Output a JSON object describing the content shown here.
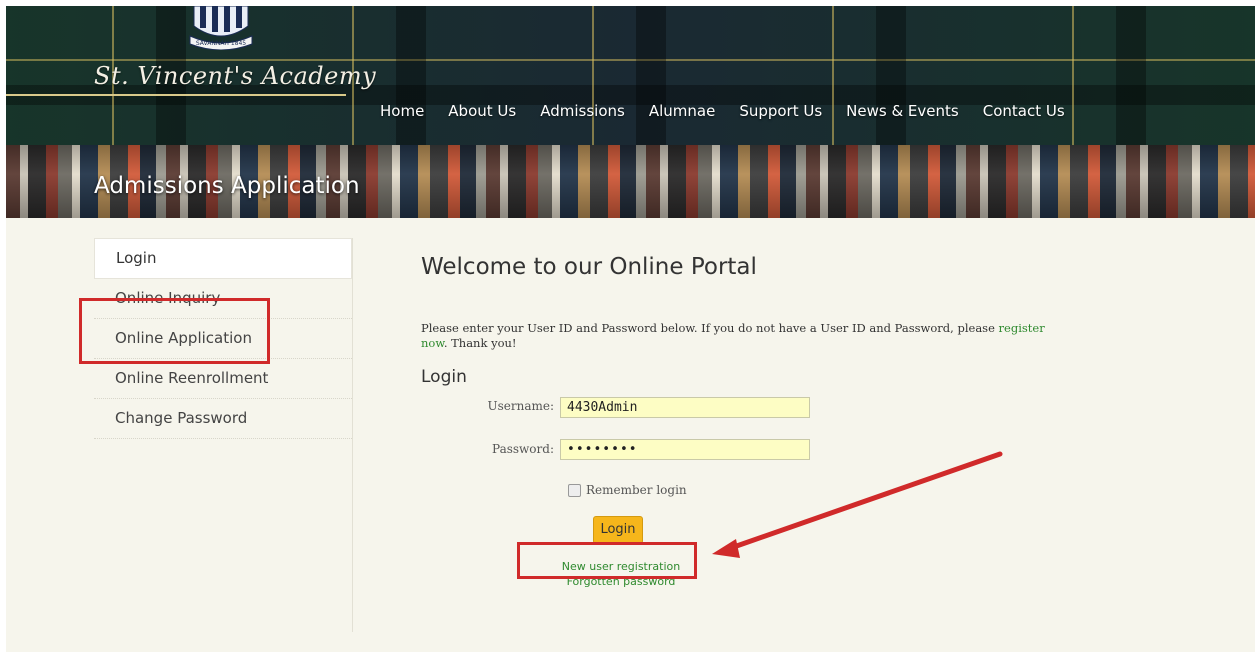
{
  "site": {
    "title": "St. Vincent's Academy",
    "crest_text": "SAVANNAH 1845"
  },
  "nav": {
    "items": [
      "Home",
      "About Us",
      "Admissions",
      "Alumnae",
      "Support Us",
      "News & Events",
      "Contact Us"
    ]
  },
  "banner": {
    "title": "Admissions Application"
  },
  "sidebar": {
    "items": [
      {
        "label": "Login",
        "active": true
      },
      {
        "label": "Online Inquiry"
      },
      {
        "label": "Online Application"
      },
      {
        "label": "Online Reenrollment"
      },
      {
        "label": "Change Password"
      }
    ]
  },
  "main": {
    "title": "Welcome to our Online Portal",
    "intro_text": "Please enter your User ID and Password below.  If you do not have a User ID and Password, please",
    "intro_link": "register now",
    "intro_end": ".  Thank you!",
    "login_heading": "Login",
    "username_label": "Username:",
    "username_value": "4430Admin",
    "password_label": "Password:",
    "password_value": "••••••••",
    "remember_label": "Remember login",
    "login_button": "Login",
    "new_user_link": "New user registration",
    "forgot_link": "Forgotten password"
  },
  "colors": {
    "background": "#f6f5ec",
    "link_green": "#2f8a2f",
    "button_orange": "#f6b61b",
    "annotation_red": "#d02a2a"
  }
}
